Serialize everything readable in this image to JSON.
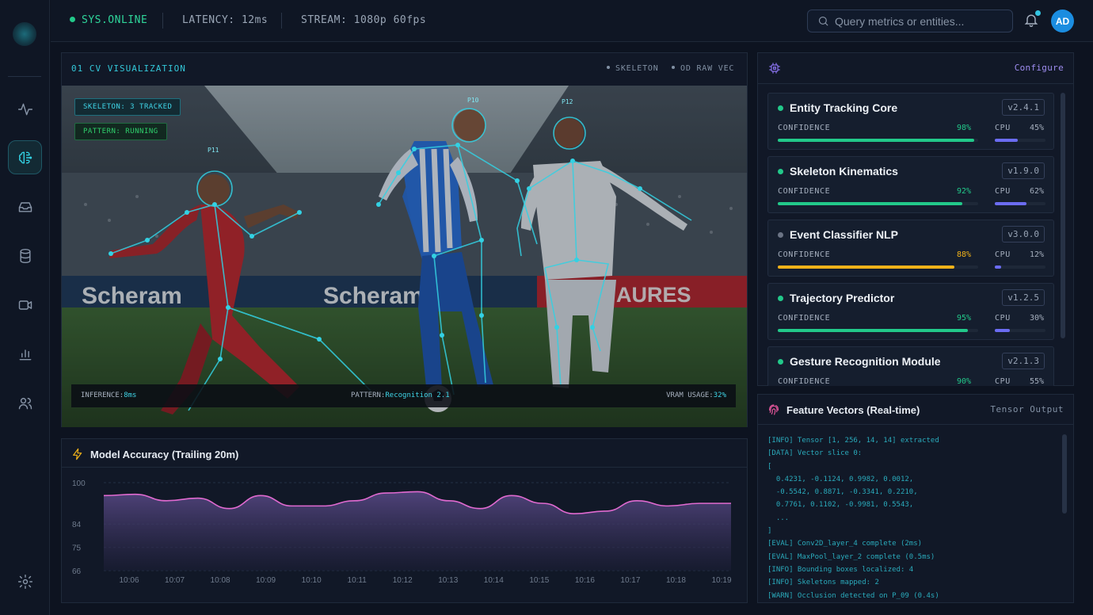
{
  "header": {
    "status": "SYS.ONLINE",
    "latency": "LATENCY: 12ms",
    "stream": "STREAM: 1080p 60fps",
    "search_placeholder": "Query metrics or entities...",
    "avatar_initials": "AD"
  },
  "sidebar": {
    "items": [
      {
        "icon": "activity-icon",
        "active": false
      },
      {
        "icon": "brain-icon",
        "active": true
      },
      {
        "icon": "inbox-icon",
        "active": false
      },
      {
        "icon": "database-icon",
        "active": false
      },
      {
        "icon": "video-icon",
        "active": false
      },
      {
        "icon": "bar-chart-icon",
        "active": false
      },
      {
        "icon": "users-icon",
        "active": false
      }
    ],
    "settings_icon": "gear-icon"
  },
  "cv": {
    "title": "01 CV VISUALIZATION",
    "tags": [
      "SKELETON",
      "OD RAW VEC"
    ],
    "badge_skeleton": "SKELETON: 3 TRACKED",
    "badge_pattern": "PATTERN: RUNNING",
    "players": [
      "P11",
      "P10",
      "P12"
    ],
    "footer": {
      "inference_label": "INFERENCE:",
      "inference_value": "8ms",
      "pattern_label": "PATTERN:",
      "pattern_value": "Recognition 2.1",
      "vram_label": "VRAM USAGE:",
      "vram_value": "32%"
    },
    "colors": {
      "skeleton": "#33d1e3"
    }
  },
  "accuracy": {
    "title": "Model Accuracy (Trailing 20m)"
  },
  "chart_data": {
    "type": "area",
    "title": "Model Accuracy (Trailing 20m)",
    "x": [
      "10:06",
      "10:07",
      "10:08",
      "10:09",
      "10:10",
      "10:11",
      "10:12",
      "10:13",
      "10:14",
      "10:15",
      "10:16",
      "10:17",
      "10:18",
      "10:19"
    ],
    "yticks": [
      100,
      84,
      75,
      66
    ],
    "ylim": [
      66,
      100
    ],
    "values": [
      95,
      95.5,
      93,
      94,
      90,
      95,
      91,
      91,
      93,
      96,
      96.5,
      93,
      90,
      95,
      92,
      88,
      89,
      93,
      91,
      92,
      92
    ],
    "grid": true,
    "colors": {
      "line": "#e06ad0",
      "fill_top": "#5a4a88",
      "fill_bottom": "#1a1d34"
    }
  },
  "models": {
    "configure_label": "Configure",
    "confidence_label": "CONFIDENCE",
    "cpu_label": "CPU",
    "items": [
      {
        "name": "Entity Tracking Core",
        "version": "v2.4.1",
        "confidence": "98%",
        "confidence_pct": 98,
        "cpu": "45%",
        "cpu_pct": 45,
        "status_color": "#22c98a",
        "bar_color": "#22c98a",
        "value_color": "#22c98a"
      },
      {
        "name": "Skeleton Kinematics",
        "version": "v1.9.0",
        "confidence": "92%",
        "confidence_pct": 92,
        "cpu": "62%",
        "cpu_pct": 62,
        "status_color": "#22c98a",
        "bar_color": "#22c98a",
        "value_color": "#22c98a"
      },
      {
        "name": "Event Classifier NLP",
        "version": "v3.0.0",
        "confidence": "88%",
        "confidence_pct": 88,
        "cpu": "12%",
        "cpu_pct": 12,
        "status_color": "#6b7485",
        "bar_color": "#f0b21a",
        "value_color": "#f0b21a"
      },
      {
        "name": "Trajectory Predictor",
        "version": "v1.2.5",
        "confidence": "95%",
        "confidence_pct": 95,
        "cpu": "30%",
        "cpu_pct": 30,
        "status_color": "#22c98a",
        "bar_color": "#22c98a",
        "value_color": "#22c98a"
      },
      {
        "name": "Gesture Recognition Module",
        "version": "v2.1.3",
        "confidence": "90%",
        "confidence_pct": 90,
        "cpu": "55%",
        "cpu_pct": 55,
        "status_color": "#22c98a",
        "bar_color": "#22c98a",
        "value_color": "#22c98a"
      }
    ]
  },
  "features": {
    "title": "Feature Vectors (Real-time)",
    "right_label": "Tensor Output",
    "log": [
      "[INFO] Tensor [1, 256, 14, 14] extracted",
      "[DATA] Vector slice 0:",
      "[",
      "  0.4231, -0.1124, 0.9982, 0.0012,",
      "  -0.5542, 0.8871, -0.3341, 0.2210,",
      "  0.7761, 0.1102, -0.9981, 0.5543,",
      "  ...",
      "]",
      "[EVAL] Conv2D_layer_4 complete (2ms)",
      "[EVAL] MaxPool_layer_2 complete (0.5ms)",
      "[INFO] Bounding boxes localized: 4",
      "[INFO] Skeletons mapped: 2",
      "[WARN] Occlusion detected on P_09 (0.4s)"
    ]
  }
}
